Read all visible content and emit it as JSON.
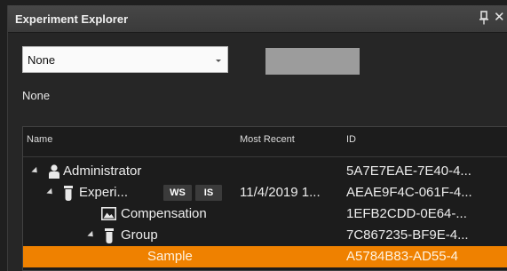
{
  "panel": {
    "title": "Experiment Explorer"
  },
  "dropdown": {
    "value": "None"
  },
  "status_text": "None",
  "grid": {
    "columns": [
      "Name",
      "Most Recent",
      "ID"
    ],
    "rows": [
      {
        "name": "Administrator",
        "most_recent": "",
        "id": "5A7E7EAE-7E40-4..."
      },
      {
        "name": "Experi...",
        "badges": [
          "WS",
          "IS"
        ],
        "most_recent": "11/4/2019 1...",
        "id": "AEAE9F4C-061F-4..."
      },
      {
        "name": "Compensation",
        "most_recent": "",
        "id": "1EFB2CDD-0E64-..."
      },
      {
        "name": "Group",
        "most_recent": "",
        "id": "7C867235-BF9E-4..."
      },
      {
        "name": "Sample",
        "most_recent": "",
        "id": "A5784B83-AD55-4",
        "selected": true
      }
    ]
  },
  "colors": {
    "selection": "#ef8100",
    "background": "#1c1c1c",
    "titlebar": "#3a3a3a"
  },
  "icons": {
    "pin": "pin-icon",
    "close": "close-icon",
    "user": "user-icon",
    "tube": "tube-icon",
    "image": "image-icon"
  }
}
